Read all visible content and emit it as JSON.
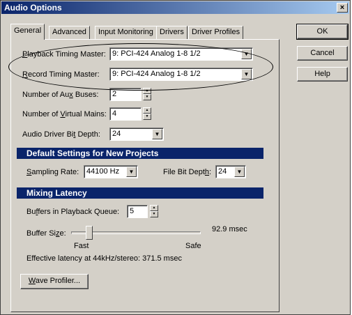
{
  "window": {
    "title": "Audio Options",
    "close_glyph": "×"
  },
  "tabs": [
    {
      "label": "General",
      "active": true
    },
    {
      "label": "Advanced",
      "active": false
    },
    {
      "label": "Input Monitoring",
      "active": false
    },
    {
      "label": "Drivers",
      "active": false
    },
    {
      "label": "Driver Profiles",
      "active": false
    }
  ],
  "general": {
    "playback_master": {
      "label_u": "P",
      "label_rest": "layback Timing Master:",
      "value": "9: PCI-424 Analog 1-8 1/2"
    },
    "record_master": {
      "label_u": "R",
      "label_rest": "ecord Timing Master:",
      "value": "9: PCI-424 Analog 1-8 1/2"
    },
    "aux_buses": {
      "label_pre": "Number of Au",
      "label_u": "x",
      "label_post": " Buses:",
      "value": "2"
    },
    "virtual_mains": {
      "label_pre": "Number of ",
      "label_u": "V",
      "label_post": "irtual Mains:",
      "value": "4"
    },
    "bit_depth": {
      "label_pre": "Audio Driver Bi",
      "label_u": "t",
      "label_post": " Depth:",
      "value": "24"
    }
  },
  "defaults_section": {
    "title": "Default Settings for New Projects",
    "sampling_rate": {
      "label_u": "S",
      "label_rest": "ampling Rate:",
      "value": "44100 Hz"
    },
    "file_bit_depth": {
      "label_pre": "File Bit Dept",
      "label_u": "h",
      "label_post": ":",
      "value": "24"
    }
  },
  "latency_section": {
    "title": "Mixing Latency",
    "buffers": {
      "label_pre": "Bu",
      "label_u": "f",
      "label_post": "fers in Playback Queue:",
      "value": "5"
    },
    "buffer_size": {
      "label_pre": "Buffer Si",
      "label_u": "z",
      "label_post": "e:",
      "readout": "92.9 msec",
      "level": 0.12
    },
    "fast_label": "Fast",
    "safe_label": "Safe",
    "effective": "Effective latency at 44kHz/stereo:  371.5 msec"
  },
  "wave_profiler": {
    "label_u": "W",
    "label_rest": "ave Profiler..."
  },
  "buttons": {
    "ok": "OK",
    "cancel": "Cancel",
    "help": "Help"
  },
  "icons": {
    "dropdown": "▼",
    "spin_up": "▲",
    "spin_down": "▼"
  }
}
